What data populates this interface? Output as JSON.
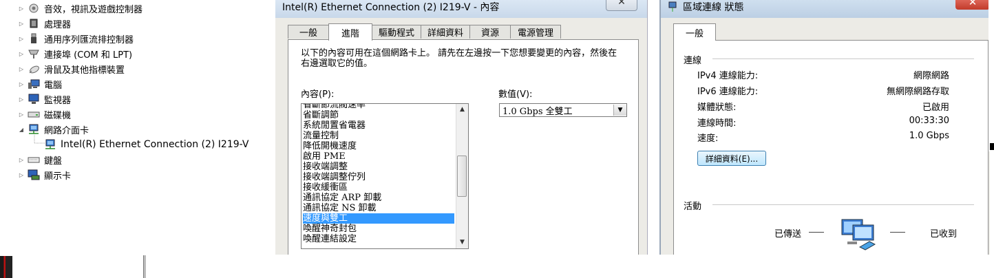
{
  "device_tree": {
    "items": [
      {
        "label": "音效，視訊及遊戲控制器",
        "icon": "speaker-icon",
        "expanded": false
      },
      {
        "label": "處理器",
        "icon": "processor-icon",
        "expanded": false
      },
      {
        "label": "通用序列匯流排控制器",
        "icon": "usb-icon",
        "expanded": false
      },
      {
        "label": "連接埠 (COM 和 LPT)",
        "icon": "port-icon",
        "expanded": false
      },
      {
        "label": "滑鼠及其他指標裝置",
        "icon": "mouse-icon",
        "expanded": false
      },
      {
        "label": "電腦",
        "icon": "computer-icon",
        "expanded": false
      },
      {
        "label": "監視器",
        "icon": "monitor-icon",
        "expanded": false
      },
      {
        "label": "磁碟機",
        "icon": "disk-drive-icon",
        "expanded": false
      },
      {
        "label": "網路介面卡",
        "icon": "network-adapter-icon",
        "expanded": true
      },
      {
        "label": "Intel(R) Ethernet Connection (2) I219-V",
        "icon": "network-adapter-icon",
        "child": true
      },
      {
        "label": "鍵盤",
        "icon": "keyboard-icon",
        "expanded": false
      },
      {
        "label": "顯示卡",
        "icon": "display-adapter-icon",
        "expanded": false
      }
    ]
  },
  "adapter_dialog": {
    "title": "Intel(R) Ethernet Connection (2) I219-V - 內容",
    "close_glyph": "✕",
    "tabs": [
      "一般",
      "進階",
      "驅動程式",
      "詳細資料",
      "資源",
      "電源管理"
    ],
    "active_tab": "進階",
    "description": "以下的內容可用在這個網路卡上。 請先在左邊按一下您想要變更的內容，然後在右邊選取它的值。",
    "property_label": "內容(P):",
    "value_label": "數值(V):",
    "properties": [
      "省斷節流閥速率",
      "省斷調節",
      "系統閒置省電器",
      "流量控制",
      "降低開機速度",
      "啟用 PME",
      "接收端調整",
      "接收端調整佇列",
      "接收緩衝區",
      "通訊協定 ARP 卸載",
      "通訊協定 NS 卸載",
      "速度與雙工",
      "喚醒神奇封包",
      "喚醒連結設定"
    ],
    "selected_property": "速度與雙工",
    "selected_value": "1.0 Gbps 全雙工"
  },
  "status_dialog": {
    "title": "區域連線 狀態",
    "close_glyph": "✕",
    "tab": "一般",
    "connection_heading": "連線",
    "rows": [
      {
        "label": "IPv4 連線能力:",
        "value": "網際網路"
      },
      {
        "label": "IPv6 連線能力:",
        "value": "無網際網路存取"
      },
      {
        "label": "媒體狀態:",
        "value": "已啟用"
      },
      {
        "label": "連線時間:",
        "value": "00:33:30"
      },
      {
        "label": "速度:",
        "value": "1.0 Gbps"
      }
    ],
    "details_button": "詳細資料(E)...",
    "activity_heading": "活動",
    "sent_label": "已傳送",
    "received_label": "已收到"
  }
}
